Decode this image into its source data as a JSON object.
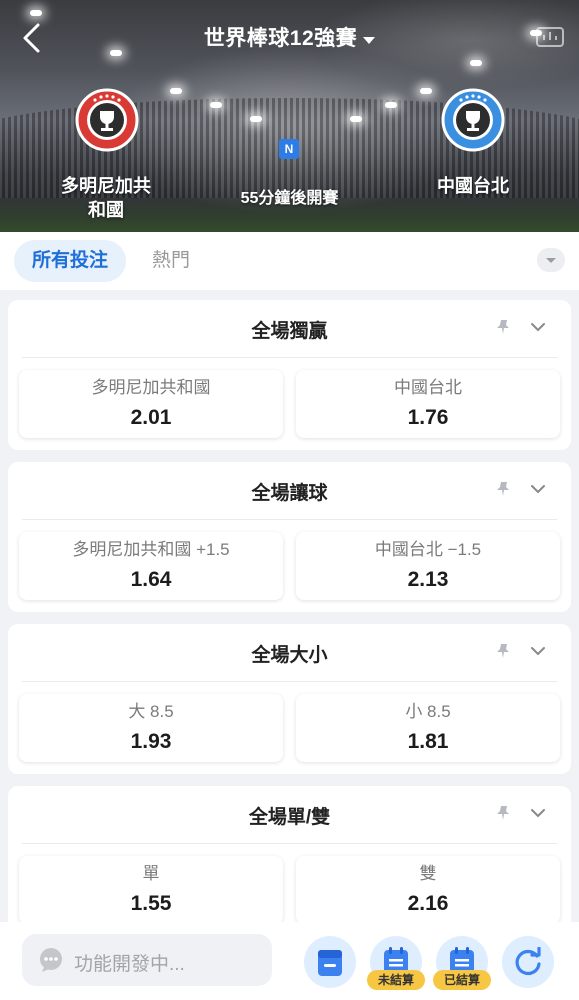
{
  "header": {
    "title": "世界棒球12強賽",
    "home_team": "多明尼加共\n和國",
    "home_team_line1": "多明尼加共",
    "home_team_line2": "和國",
    "away_team": "中國台北",
    "neutral_badge": "N",
    "status": "55分鐘後開賽"
  },
  "tabs": [
    {
      "label": "所有投注",
      "active": true
    },
    {
      "label": "熱門",
      "active": false
    }
  ],
  "markets": [
    {
      "title": "全場獨贏",
      "options": [
        {
          "label": "多明尼加共和國",
          "odds": "2.01"
        },
        {
          "label": "中國台北",
          "odds": "1.76"
        }
      ]
    },
    {
      "title": "全場讓球",
      "options": [
        {
          "label": "多明尼加共和國 +1.5",
          "odds": "1.64"
        },
        {
          "label": "中國台北 −1.5",
          "odds": "2.13"
        }
      ]
    },
    {
      "title": "全場大小",
      "options": [
        {
          "label": "大 8.5",
          "odds": "1.93"
        },
        {
          "label": "小 8.5",
          "odds": "1.81"
        }
      ]
    },
    {
      "title": "全場單/雙",
      "options": [
        {
          "label": "單",
          "odds": "1.55"
        },
        {
          "label": "雙",
          "odds": "2.16"
        }
      ]
    }
  ],
  "bottom_bar": {
    "chat_placeholder": "功能開發中...",
    "unsettled_label": "未結算",
    "settled_label": "已結算"
  },
  "colors": {
    "accent": "#1f6fd8",
    "tab_active_bg": "#e6f1fc",
    "badge_home": "#d93a34",
    "badge_away": "#3a8fe0",
    "tag_yellow": "#f7c744"
  },
  "icons": [
    "back-chevron-icon",
    "dropdown-caret-icon",
    "trophy-icon",
    "pin-icon",
    "chevron-down-icon",
    "chat-bubble-icon",
    "bet-slip-icon",
    "calendar-icon",
    "refresh-icon"
  ]
}
